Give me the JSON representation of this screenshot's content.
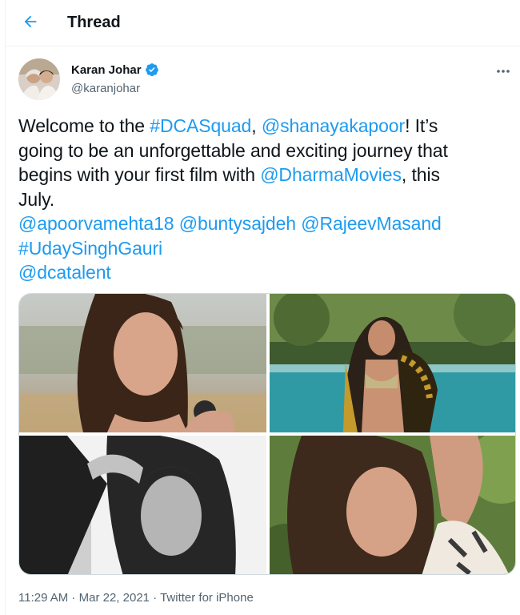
{
  "header": {
    "title": "Thread",
    "back_icon": "arrow-left-icon",
    "accent_color": "#1d9bf0"
  },
  "tweet": {
    "author": {
      "name": "Karan Johar",
      "handle": "@karanjohar",
      "verified": true
    },
    "more_icon": "more-horizontal-icon",
    "text": {
      "l1_a": "Welcome to the ",
      "l1_tag": "#DCASquad",
      "l1_b": ", ",
      "l1_mention": "@shanayakapoor",
      "l1_c": "! It’s",
      "l2": "going to be an unforgettable and exciting journey that",
      "l3_a": "begins with your first film with ",
      "l3_mention": "@DharmaMovies",
      "l3_b": ", this",
      "l4": "July.",
      "l5_m1": "@apoorvamehta18",
      "l5_m2": "@buntysajdeh",
      "l5_m3": "@RajeevMasand",
      "l6_tag": "#UdaySinghGauri",
      "l7_mention": "@dcatalent"
    },
    "media_count": 4,
    "meta": {
      "time": "11:29 AM",
      "sep1": " · ",
      "date": "Mar 22, 2021",
      "sep2": " · ",
      "source": "Twitter for iPhone"
    }
  }
}
